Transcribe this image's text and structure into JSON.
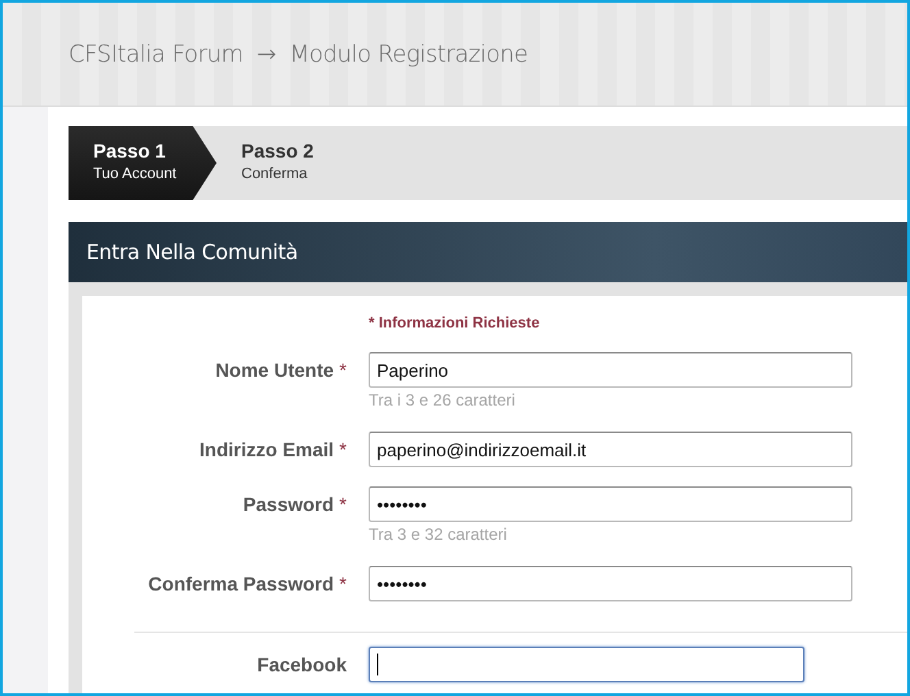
{
  "breadcrumb": {
    "site": "CFSItalia Forum",
    "separator": "→",
    "page": "Modulo Registrazione"
  },
  "steps": [
    {
      "title": "Passo 1",
      "subtitle": "Tuo Account",
      "selected": true
    },
    {
      "title": "Passo 2",
      "subtitle": "Conferma",
      "selected": false
    }
  ],
  "panel": {
    "title": "Entra Nella Comunità",
    "required_note": "* Informazioni Richieste"
  },
  "fields": [
    {
      "label": "Nome Utente",
      "required_mark": "*",
      "value": "Paperino",
      "hint": "Tra i 3 e 26 caratteri",
      "focused": false
    },
    {
      "label": "Indirizzo Email",
      "required_mark": "*",
      "value": "paperino@indirizzoemail.it",
      "focused": false
    },
    {
      "label": "Password",
      "required_mark": "*",
      "value": "••••••••",
      "hint": "Tra 3 e 32 caratteri",
      "focused": false
    },
    {
      "label": "Conferma Password",
      "required_mark": "*",
      "value": "••••••••",
      "focused": false
    }
  ],
  "optional_fields": [
    {
      "label": "Facebook",
      "focused": true
    }
  ]
}
